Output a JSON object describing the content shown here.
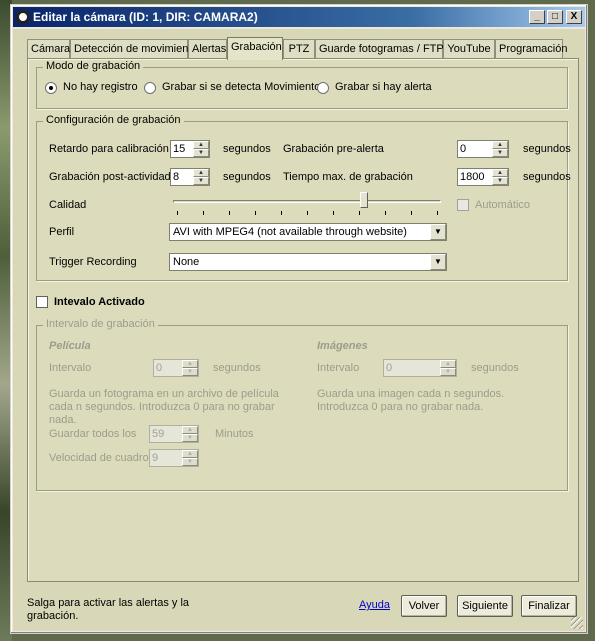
{
  "window": {
    "title": "Editar la cámara (ID: 1, DIR: CAMARA2)",
    "buttons": [
      "_",
      "□",
      "X"
    ]
  },
  "tabs": [
    {
      "label": "Cámara"
    },
    {
      "label": "Detección de movimiento"
    },
    {
      "label": "Alertas"
    },
    {
      "label": "Grabación"
    },
    {
      "label": "PTZ"
    },
    {
      "label": "Guarde fotogramas / FTP"
    },
    {
      "label": "YouTube"
    },
    {
      "label": "Programación"
    }
  ],
  "active_tab": "Grabación",
  "mode_group": {
    "title": "Modo de grabación",
    "options": [
      {
        "label": "No hay registro",
        "selected": true
      },
      {
        "label": "Grabar si se detecta Movimiento",
        "selected": false
      },
      {
        "label": "Grabar si hay alerta",
        "selected": false
      }
    ]
  },
  "config_group": {
    "title": "Configuración de grabación",
    "calib_label": "Retardo para calibración",
    "calib_value": "15",
    "calib_unit": "segundos",
    "prealert_label": "Grabación pre-alerta",
    "prealert_value": "0",
    "prealert_unit": "segundos",
    "postact_label": "Grabación post-actividad",
    "postact_value": "8",
    "postact_unit": "segundos",
    "maxtime_label": "Tiempo max. de grabación",
    "maxtime_value": "1800",
    "maxtime_unit": "segundos",
    "quality_label": "Calidad",
    "quality_level": 0.72,
    "auto_label": "Automático",
    "profile_label": "Perfil",
    "profile_value": "AVI with MPEG4 (not available through website)",
    "trigger_label": "Trigger Recording",
    "trigger_value": "None"
  },
  "interval_toggle": {
    "label": "Intevalo Activado",
    "checked": false
  },
  "interval_group": {
    "title": "Intervalo de grabación",
    "movie": {
      "heading": "Película",
      "interval_label": "Intervalo",
      "interval_value": "0",
      "interval_unit": "segundos",
      "help": "Guarda un fotograma en un archivo de película cada n segundos.  Introduzca 0 para no grabar nada.",
      "saveall_label": "Guardar todos los",
      "saveall_value": "59",
      "saveall_unit": "Minutos",
      "fps_label": "Velocidad de cuadro",
      "fps_value": "9"
    },
    "images": {
      "heading": "Imágenes",
      "interval_label": "Intervalo",
      "interval_value": "0",
      "interval_unit": "segundos",
      "help": "Guarda una imagen cada n segundos.  Introduzca 0 para no grabar nada."
    }
  },
  "footer": {
    "note": "Salga para activar las alertas y la grabación.",
    "help_link": "Ayuda",
    "back": "Volver",
    "next": "Siguiente",
    "finish": "Finalizar"
  }
}
